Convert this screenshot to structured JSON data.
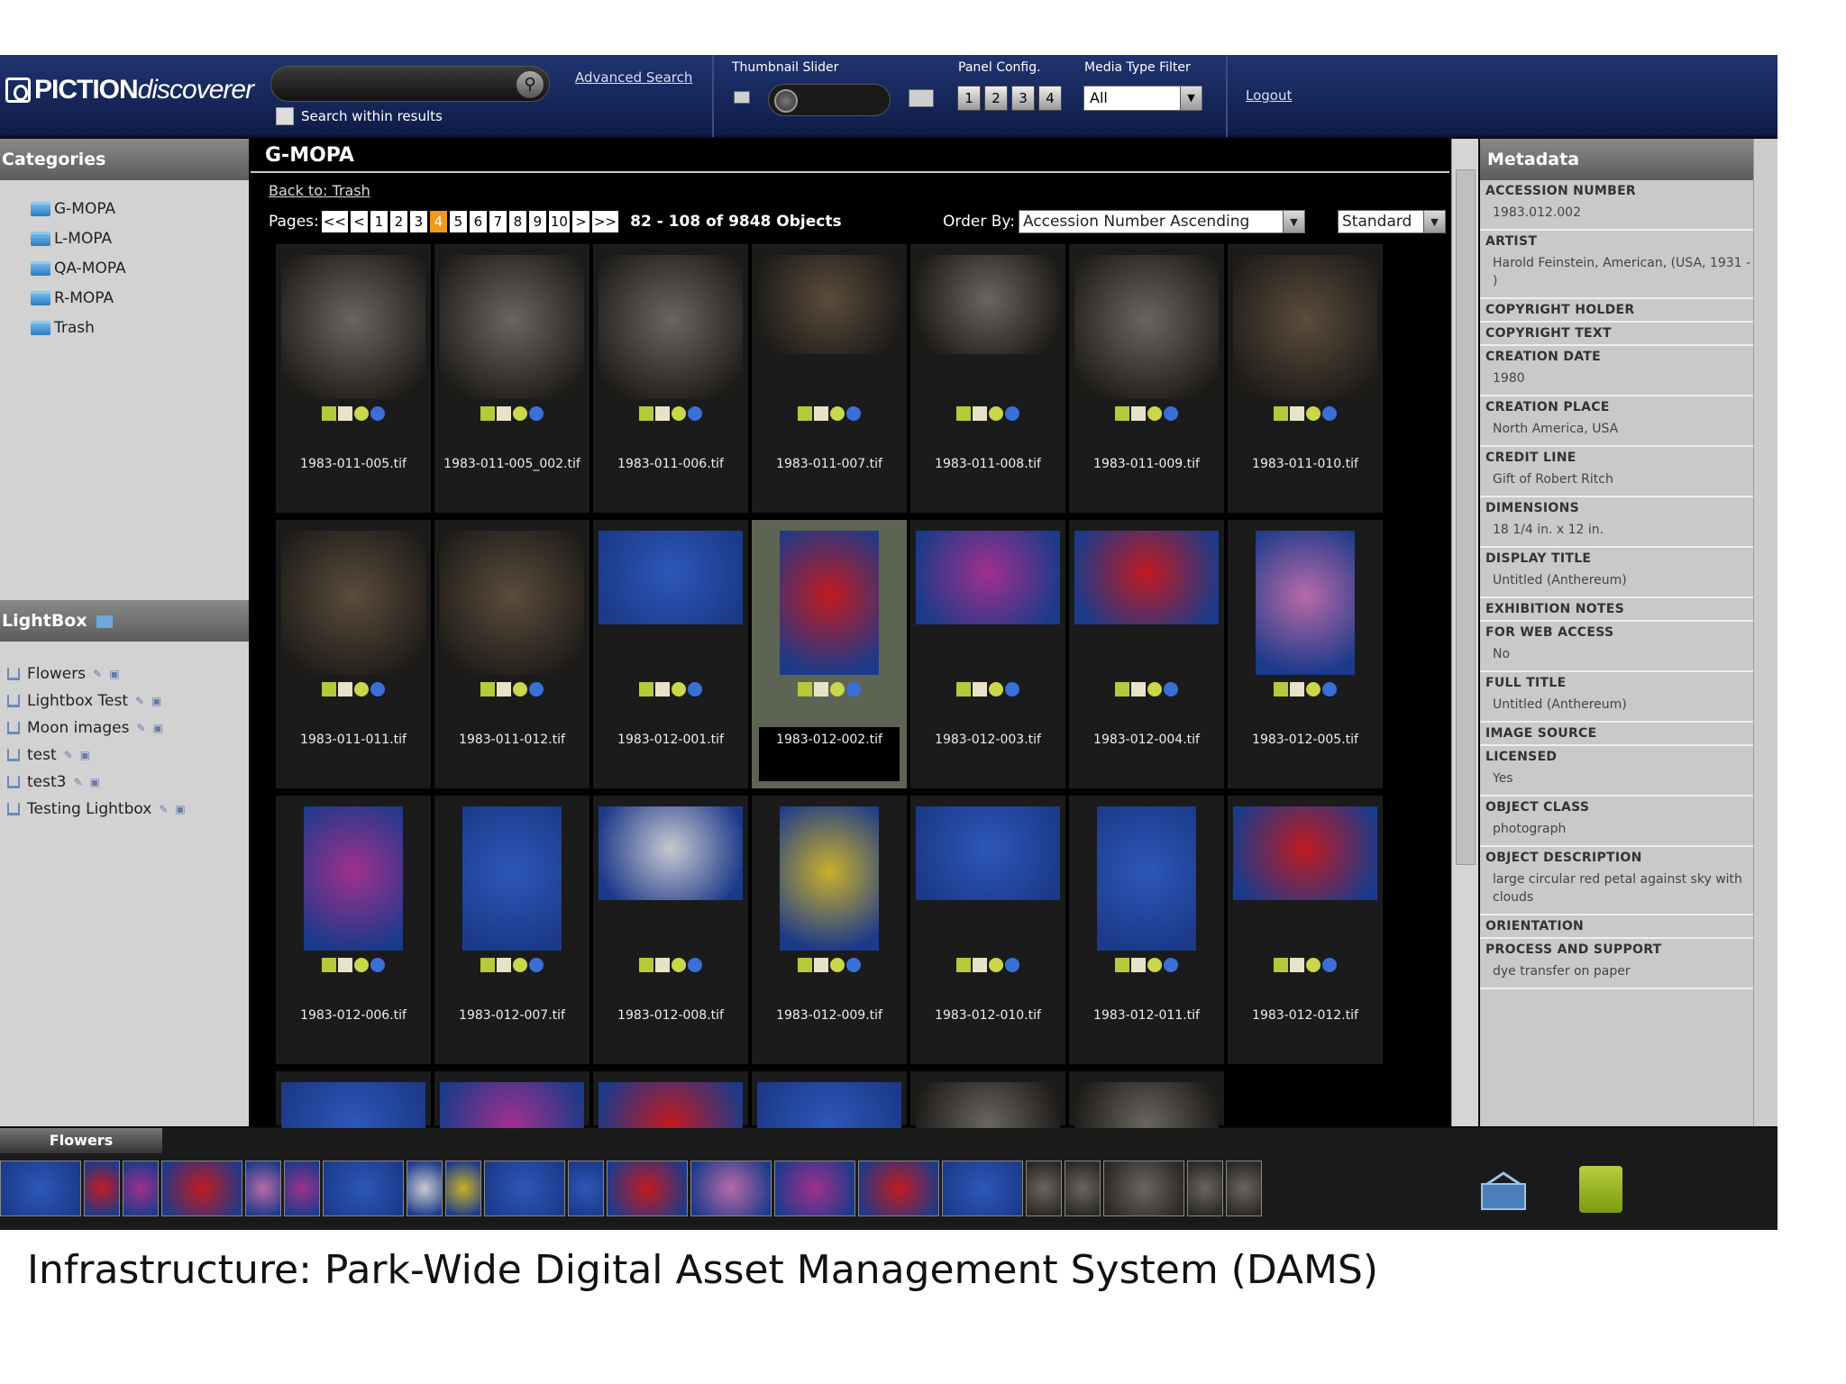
{
  "topbar": {
    "logo_bold": "PICTION",
    "logo_light": "discoverer",
    "search_placeholder": "",
    "search_within": "Search within results",
    "advanced_search": "Advanced Search",
    "thumbnail_slider": "Thumbnail Slider",
    "panel_config": "Panel Config.",
    "panel_buttons": [
      "1",
      "2",
      "3",
      "4"
    ],
    "media_type_filter": "Media Type Filter",
    "media_type_value": "All",
    "logout": "Logout"
  },
  "categories": {
    "title": "Categories",
    "items": [
      "G-MOPA",
      "L-MOPA",
      "QA-MOPA",
      "R-MOPA",
      "Trash"
    ]
  },
  "lightbox": {
    "title": "LightBox",
    "items": [
      "Flowers",
      "Lightbox Test",
      "Moon images",
      "test",
      "test3",
      "Testing Lightbox"
    ]
  },
  "center": {
    "title": "G-MOPA",
    "back_link": "Back to: Trash",
    "pages_label": "Pages:",
    "pages": [
      "<<",
      "<",
      "1",
      "2",
      "3",
      "4",
      "5",
      "6",
      "7",
      "8",
      "9",
      "10",
      ">",
      ">>"
    ],
    "current_page": "4",
    "count": "82 - 108 of 9848 Objects",
    "order_by_label": "Order By:",
    "order_by_value": "Accession Number Ascending",
    "view_value": "Standard",
    "items": [
      {
        "file": "1983-011-005.tif",
        "tone": "bw"
      },
      {
        "file": "1983-011-005_002.tif",
        "tone": "bw"
      },
      {
        "file": "1983-011-006.tif",
        "tone": "bw"
      },
      {
        "file": "1983-011-007.tif",
        "tone": "sepia"
      },
      {
        "file": "1983-011-008.tif",
        "tone": "bw"
      },
      {
        "file": "1983-011-009.tif",
        "tone": "bw"
      },
      {
        "file": "1983-011-010.tif",
        "tone": "sepia"
      },
      {
        "file": "1983-011-011.tif",
        "tone": "sepia"
      },
      {
        "file": "1983-011-012.tif",
        "tone": "sepia"
      },
      {
        "file": "1983-012-001.tif",
        "tone": "blue"
      },
      {
        "file": "1983-012-002.tif",
        "tone": "red"
      },
      {
        "file": "1983-012-003.tif",
        "tone": "magenta"
      },
      {
        "file": "1983-012-004.tif",
        "tone": "red"
      },
      {
        "file": "1983-012-005.tif",
        "tone": "pink"
      },
      {
        "file": "1983-012-006.tif",
        "tone": "magenta"
      },
      {
        "file": "1983-012-007.tif",
        "tone": "blue"
      },
      {
        "file": "1983-012-008.tif",
        "tone": "white"
      },
      {
        "file": "1983-012-009.tif",
        "tone": "yellow"
      },
      {
        "file": "1983-012-010.tif",
        "tone": "blue"
      },
      {
        "file": "1983-012-011.tif",
        "tone": "blue"
      },
      {
        "file": "1983-012-012.tif",
        "tone": "red"
      },
      {
        "file": "",
        "tone": "blue"
      },
      {
        "file": "",
        "tone": "magenta"
      },
      {
        "file": "",
        "tone": "red"
      },
      {
        "file": "",
        "tone": "blue"
      },
      {
        "file": "",
        "tone": "bw"
      },
      {
        "file": "",
        "tone": "bw"
      }
    ]
  },
  "metadata": {
    "title": "Metadata",
    "fields": [
      {
        "label": "ACCESSION NUMBER",
        "value": "1983.012.002"
      },
      {
        "label": "ARTIST",
        "value": "Harold Feinstein, American, (USA, 1931 - )"
      },
      {
        "label": "COPYRIGHT HOLDER",
        "value": ""
      },
      {
        "label": "COPYRIGHT TEXT",
        "value": ""
      },
      {
        "label": "CREATION DATE",
        "value": "1980"
      },
      {
        "label": "CREATION PLACE",
        "value": "North America, USA"
      },
      {
        "label": "CREDIT LINE",
        "value": "Gift of Robert Ritch"
      },
      {
        "label": "DIMENSIONS",
        "value": "18 1/4 in. x 12 in."
      },
      {
        "label": "DISPLAY TITLE",
        "value": "Untitled (Anthereum)"
      },
      {
        "label": "EXHIBITION NOTES",
        "value": ""
      },
      {
        "label": "FOR WEB ACCESS",
        "value": "No"
      },
      {
        "label": "FULL TITLE",
        "value": "Untitled (Anthereum)"
      },
      {
        "label": "IMAGE SOURCE",
        "value": ""
      },
      {
        "label": "LICENSED",
        "value": "Yes"
      },
      {
        "label": "OBJECT CLASS",
        "value": "photograph"
      },
      {
        "label": "OBJECT DESCRIPTION",
        "value": "large circular red petal against sky with clouds"
      },
      {
        "label": "ORIENTATION",
        "value": ""
      },
      {
        "label": "PROCESS AND SUPPORT",
        "value": "dye transfer on paper"
      }
    ]
  },
  "bottom": {
    "tab": "Flowers",
    "strip_tones": [
      "blue",
      "red",
      "magenta",
      "red",
      "pink",
      "magenta",
      "blue",
      "white",
      "yellow",
      "blue",
      "blue",
      "red",
      "pink",
      "magenta",
      "red",
      "blue",
      "bw",
      "bw",
      "bw",
      "bw",
      "bw"
    ]
  },
  "colors": {
    "bw": "#6a6560",
    "sepia": "#5b4c3c",
    "blue": "#2d57b8",
    "red": "#c21a20",
    "magenta": "#a0308c",
    "pink": "#b86aa8",
    "white": "#c8c8d0",
    "yellow": "#c9b02a"
  },
  "caption": "Infrastructure: Park-Wide Digital Asset Management System (DAMS)"
}
